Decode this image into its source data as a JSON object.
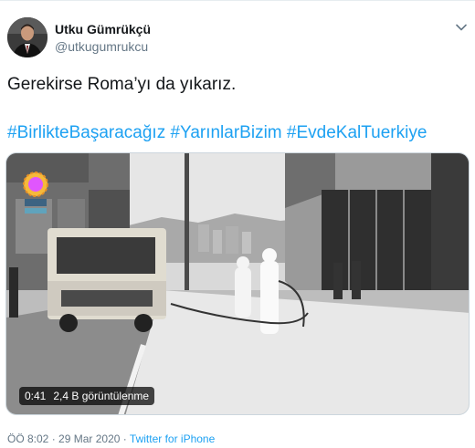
{
  "author": {
    "display_name": "Utku Gümrükçü",
    "handle": "@utkugumrukcu"
  },
  "tweet": {
    "text": "Gerekirse Roma’yı da yıkarız.",
    "hashtags": [
      "#BirlikteBaşaracağız",
      "#YarınlarBizim",
      "#EvdeKalTuerkiye"
    ]
  },
  "media": {
    "duration": "0:41",
    "views": "2,4 B görüntülenme"
  },
  "meta": {
    "time": "ÖÖ 8:02",
    "date": "29 Mar 2020",
    "separator": "·",
    "source": "Twitter for iPhone"
  },
  "icons": {
    "more": "chevron-down-icon",
    "avatar": "avatar-portrait"
  },
  "colors": {
    "link": "#1da1f2",
    "secondary_text": "#657786",
    "primary_text": "#14171a"
  }
}
